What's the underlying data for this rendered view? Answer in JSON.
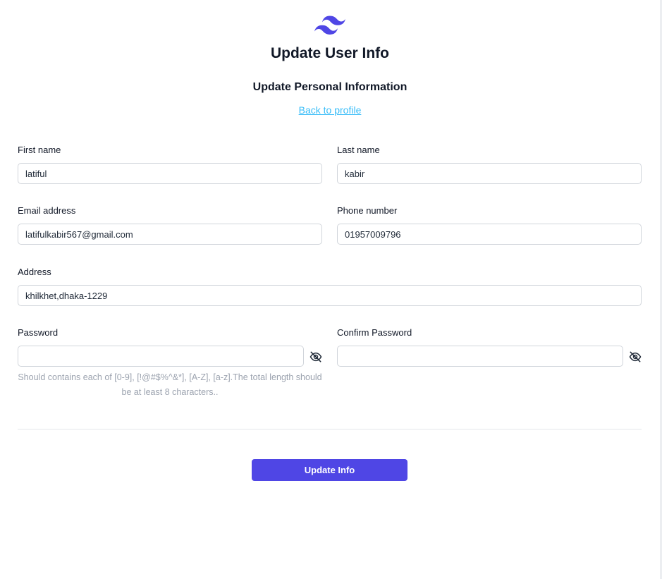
{
  "header": {
    "logo_icon": "tailwind-logo-icon",
    "title": "Update User Info",
    "subtitle": "Update Personal Information",
    "back_link": "Back to profile"
  },
  "form": {
    "first_name": {
      "label": "First name",
      "value": "latiful"
    },
    "last_name": {
      "label": "Last name",
      "value": "kabir"
    },
    "email": {
      "label": "Email address",
      "value": "latifulkabir567@gmail.com"
    },
    "phone": {
      "label": "Phone number",
      "value": "01957009796"
    },
    "address": {
      "label": "Address",
      "value": "khilkhet,dhaka-1229"
    },
    "password": {
      "label": "Password",
      "value": "",
      "toggle_icon": "eye-slash-icon",
      "hint": "Should contains each of [0-9], [!@#$%^&*], [A-Z], [a-z].The total length should be at least 8 characters.."
    },
    "confirm_password": {
      "label": "Confirm Password",
      "value": "",
      "toggle_icon": "eye-slash-icon"
    },
    "submit_label": "Update Info"
  },
  "colors": {
    "brand": "#4f46e5",
    "link": "#38bdf8",
    "hint": "#9ca3af",
    "border": "#d1d5db"
  }
}
